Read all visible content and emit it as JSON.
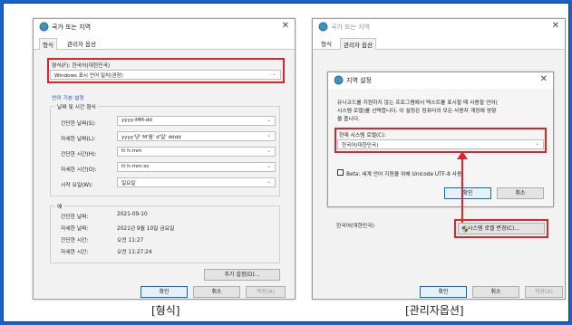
{
  "colors": {
    "outer_border": "#1a62c9",
    "highlight": "#e0242b",
    "link_blue": "#1a4fb0",
    "dialog_bg": "#f2f2f2"
  },
  "left": {
    "window_title": "국가 또는 지역",
    "tabs": [
      "형식",
      "관리자 옵션"
    ],
    "format_label": "형식(F): 한국어(대한민국)",
    "format_value": "Windows 표시 언어 일치(권장)",
    "lang_pref_link": "언어 기본 설정",
    "datetime_header": "날짜 및 시간 형식",
    "fields": [
      {
        "label": "간단한 날짜(S):",
        "value": "yyyy-MM-dd"
      },
      {
        "label": "자세한 날짜(L):",
        "value": "yyyy'년' M'월' d'일' dddd"
      },
      {
        "label": "간단한 시간(H):",
        "value": "tt h:mm"
      },
      {
        "label": "자세한 시간(O):",
        "value": "tt h:mm:ss"
      },
      {
        "label": "시작 요일(W):",
        "value": "일요일"
      }
    ],
    "example_header": "예",
    "examples": [
      {
        "label": "간단한 날짜:",
        "value": "2021-09-10"
      },
      {
        "label": "자세한 날짜:",
        "value": "2021년 9월 10일 금요일"
      },
      {
        "label": "간단한 시간:",
        "value": "오전 11:27"
      },
      {
        "label": "자세한 시간:",
        "value": "오전 11:27:24"
      }
    ],
    "additional_button": "추가 설정(D)...",
    "ok": "확인",
    "cancel": "취소",
    "apply": "적용(A)",
    "caption": "[형식]"
  },
  "right": {
    "window_title": "국가 또는 지역",
    "tabs": [
      "형식",
      "관리자 옵션"
    ],
    "locale_text": "한국어(대한민국)",
    "change_locale_button": "시스템 로캘 변경(C)...",
    "ok": "확인",
    "cancel": "취소",
    "apply": "적용(A)",
    "caption": "[관리자옵션]",
    "inner_dialog": {
      "title": "지역 설정",
      "description_1": "유니코드를 지원하지 않는 프로그램에서 텍스트를 표시할 때 사용할 언어(",
      "description_2": "시스템 로캘)를 선택합니다. 이 설정은 컴퓨터의 모든 사용자 계정에 영향",
      "description_3": "을 줍니다.",
      "current_label": "현재 시스템 로캘(C):",
      "current_value": "한국어(대한민국)",
      "beta_label": "Beta: 세계 언어 지원을 위해 Unicode UTF-8 사용",
      "ok": "확인",
      "cancel": "취소"
    }
  }
}
